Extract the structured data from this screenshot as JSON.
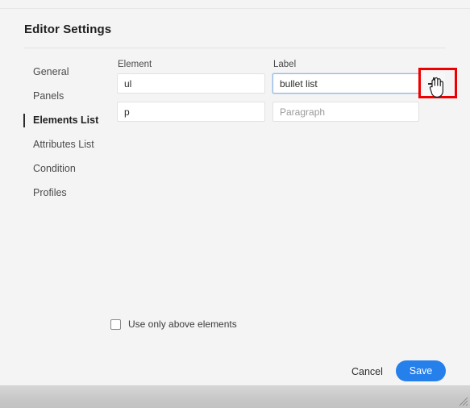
{
  "dialog": {
    "title": "Editor Settings"
  },
  "sidebar": {
    "items": [
      {
        "label": "General",
        "active": false
      },
      {
        "label": "Panels",
        "active": false
      },
      {
        "label": "Elements List",
        "active": true
      },
      {
        "label": "Attributes List",
        "active": false
      },
      {
        "label": "Condition",
        "active": false
      },
      {
        "label": "Profiles",
        "active": false
      }
    ]
  },
  "elements_list": {
    "columns": {
      "element": "Element",
      "label": "Label"
    },
    "rows": [
      {
        "element": "ul",
        "label": "bullet list",
        "label_focused": true,
        "label_muted": false
      },
      {
        "element": "p",
        "label": "Paragraph",
        "label_focused": false,
        "label_muted": true
      }
    ],
    "add_button": {
      "icon": "plus-icon",
      "title": "Add element"
    }
  },
  "options": {
    "use_only_above_elements": {
      "label": "Use only above elements",
      "checked": false
    }
  },
  "footer": {
    "cancel_label": "Cancel",
    "save_label": "Save"
  },
  "annotation": {
    "highlight_color": "#ef0000",
    "cursor": "hand-pointer-cursor"
  },
  "colors": {
    "background": "#f4f4f4",
    "accent_blue": "#2680eb",
    "field_focus_border": "#8fb9e8",
    "text_primary": "#1f1f1f",
    "text_secondary": "#4b4b4b",
    "text_muted": "#9a9a9a"
  }
}
